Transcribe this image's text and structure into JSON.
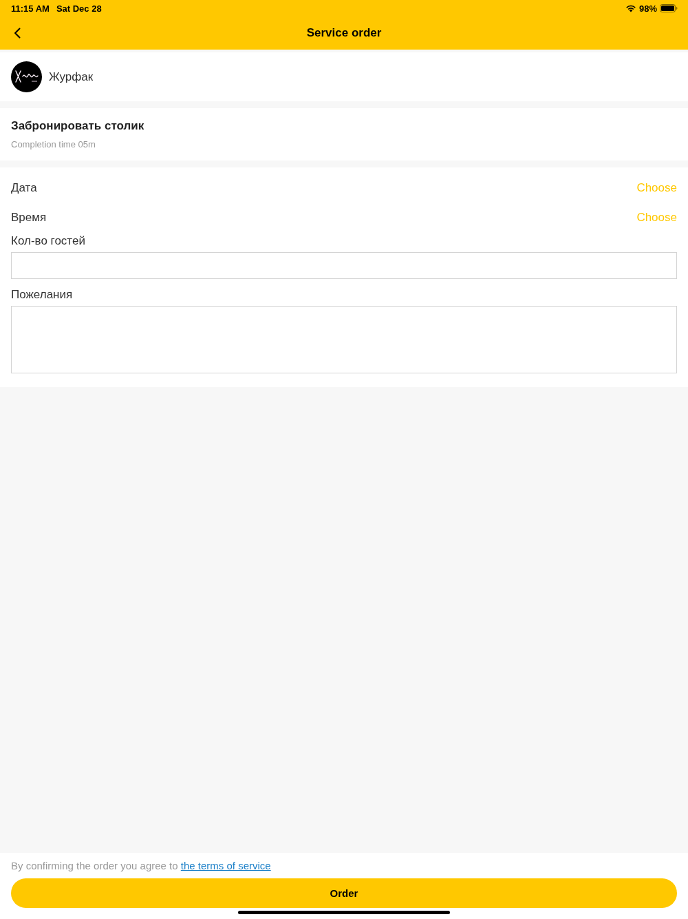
{
  "status_bar": {
    "time": "11:15 AM",
    "date": "Sat Dec 28",
    "battery": "98%"
  },
  "nav_bar": {
    "title": "Service order"
  },
  "shop": {
    "name": "Журфак"
  },
  "service": {
    "title": "Забронировать столик",
    "completion_time": "Completion time 05m"
  },
  "form": {
    "fields": [
      {
        "kind": "picker",
        "label": "Дата",
        "action": "Choose"
      },
      {
        "kind": "picker",
        "label": "Время",
        "action": "Choose"
      },
      {
        "kind": "input",
        "label": "Кол-во гостей"
      },
      {
        "kind": "textarea",
        "label": "Пожелания"
      }
    ]
  },
  "footer": {
    "agreement": "By confirming the order you agree to",
    "terms_link": "the terms of service",
    "order_button": "Order"
  }
}
